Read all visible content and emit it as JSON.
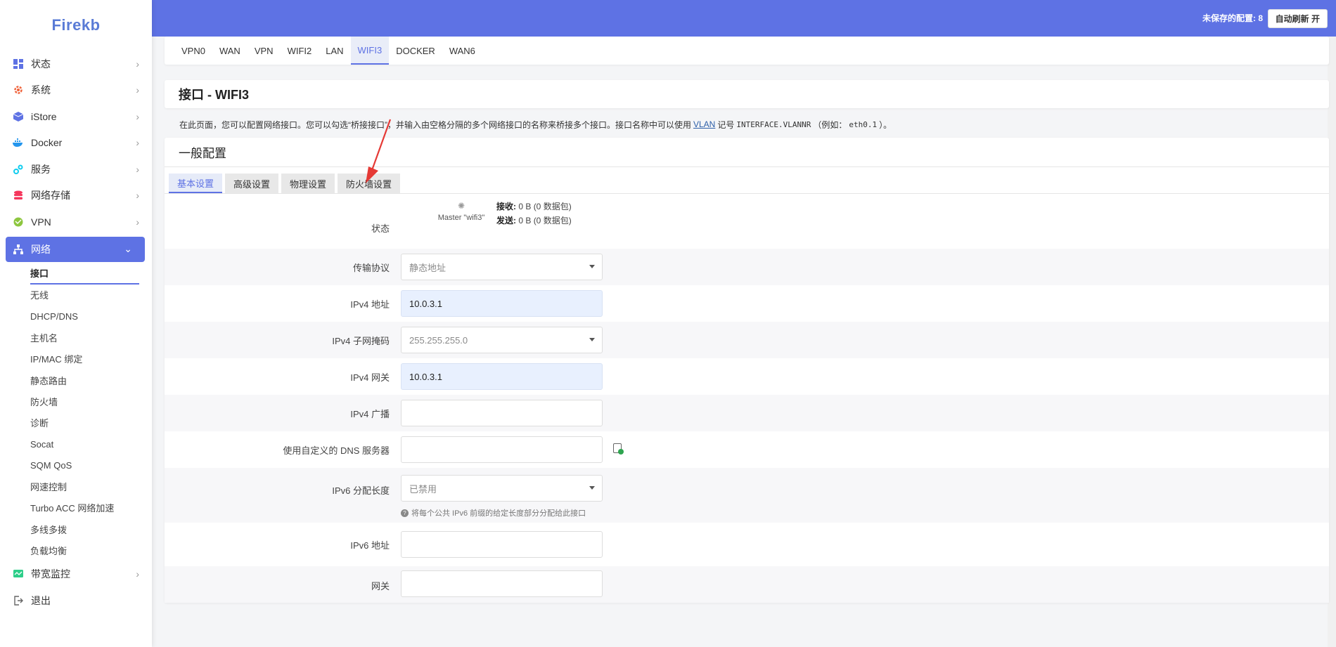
{
  "brand": "Firekb",
  "topbar": {
    "unsaved": "未保存的配置: 8",
    "autorefresh": "自动刷新 开"
  },
  "sidebar": {
    "items": [
      {
        "label": "状态",
        "icon": "dashboard-icon",
        "color": "#5e72e4"
      },
      {
        "label": "系统",
        "icon": "gear-icon",
        "color": "#f0643c"
      },
      {
        "label": "iStore",
        "icon": "cube-icon",
        "color": "#5e72e4"
      },
      {
        "label": "Docker",
        "icon": "docker-icon",
        "color": "#2496ed"
      },
      {
        "label": "服务",
        "icon": "services-icon",
        "color": "#11cdef"
      },
      {
        "label": "网络存储",
        "icon": "storage-icon",
        "color": "#f5365c"
      },
      {
        "label": "VPN",
        "icon": "vpn-icon",
        "color": "#8dc63f"
      }
    ],
    "active": {
      "label": "网络",
      "icon": "network-icon"
    },
    "submenu": [
      "接口",
      "无线",
      "DHCP/DNS",
      "主机名",
      "IP/MAC 绑定",
      "静态路由",
      "防火墙",
      "诊断",
      "Socat",
      "SQM QoS",
      "网速控制",
      "Turbo ACC 网络加速",
      "多线多拨",
      "负载均衡"
    ],
    "bottom": [
      {
        "label": "带宽监控",
        "icon": "monitor-icon",
        "color": "#2dce89"
      },
      {
        "label": "退出",
        "icon": "logout-icon",
        "color": "#666666"
      }
    ]
  },
  "tabs": [
    "VPN0",
    "WAN",
    "VPN",
    "WIFI2",
    "LAN",
    "WIFI3",
    "DOCKER",
    "WAN6"
  ],
  "active_tab": "WIFI3",
  "page_title": "接口 - WIFI3",
  "description": {
    "before": "在此页面，您可以配置网络接口。您可以勾选“桥接接口”，并输入由空格分隔的多个网络接口的名称来桥接多个接口。接口名称中可以使用",
    "vlan": "VLAN",
    "mid": "记号",
    "code1": "INTERFACE.VLANNR",
    "after1": "（例如：",
    "code2": "eth0.1",
    "after2": "）。"
  },
  "section_title": "一般配置",
  "subtabs": [
    "基本设置",
    "高级设置",
    "物理设置",
    "防火墙设置"
  ],
  "status": {
    "label": "状态",
    "device": "Master \"wifi3\"",
    "rx_label": "接收:",
    "rx_value": "0 B (0 数据包)",
    "tx_label": "发送:",
    "tx_value": "0 B (0 数据包)"
  },
  "fields": {
    "protocol": {
      "label": "传输协议",
      "value": "静态地址"
    },
    "ipv4_addr": {
      "label": "IPv4 地址",
      "value": "10.0.3.1"
    },
    "ipv4_mask": {
      "label": "IPv4 子网掩码",
      "value": "255.255.255.0"
    },
    "ipv4_gw": {
      "label": "IPv4 网关",
      "value": "10.0.3.1"
    },
    "ipv4_bcast": {
      "label": "IPv4 广播",
      "value": ""
    },
    "dns": {
      "label": "使用自定义的 DNS 服务器",
      "value": ""
    },
    "ipv6_len": {
      "label": "IPv6 分配长度",
      "value": "已禁用",
      "help": "将每个公共 IPv6 前缀的给定长度部分分配给此接口"
    },
    "ipv6_addr": {
      "label": "IPv6 地址",
      "value": ""
    },
    "next": {
      "label": "网关",
      "value": ""
    }
  },
  "colors": {
    "accent": "#5e72e4",
    "annotation_arrow": "#e53935"
  }
}
